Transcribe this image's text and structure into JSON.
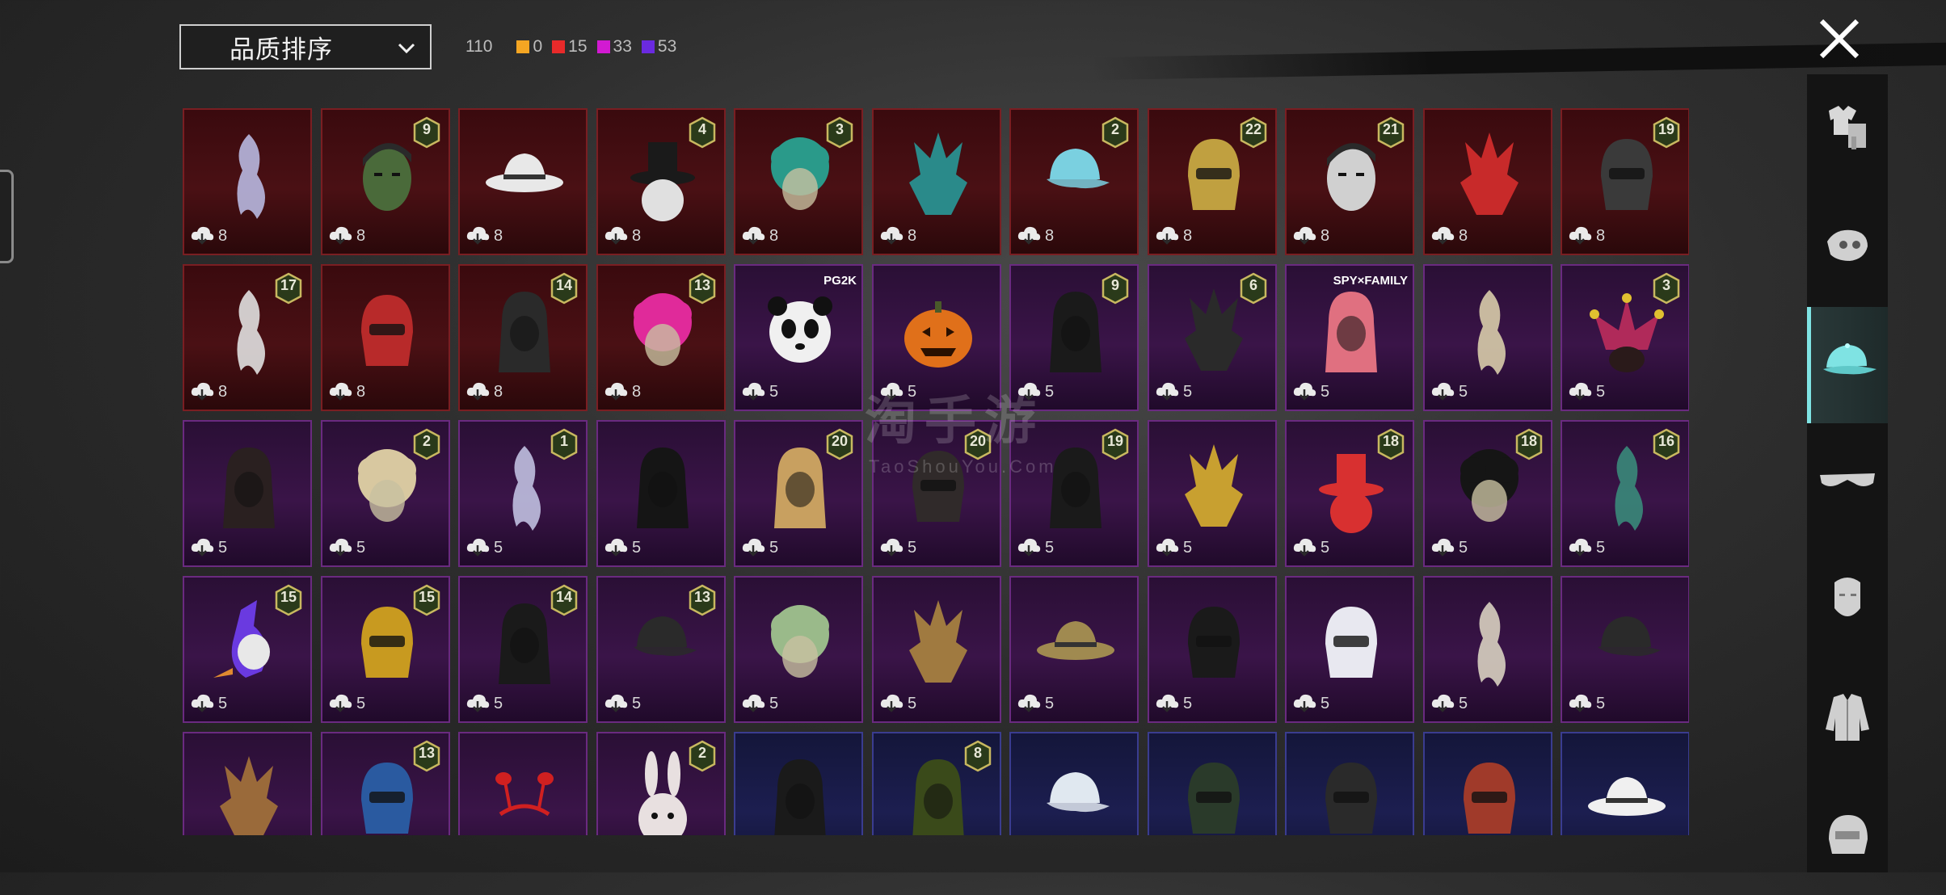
{
  "sort": {
    "label": "品质排序"
  },
  "counts": {
    "total": "110",
    "qualities": [
      {
        "color": "#f5a623",
        "value": "0"
      },
      {
        "color": "#e82a2a",
        "value": "15"
      },
      {
        "color": "#d21ad2",
        "value": "33"
      },
      {
        "color": "#6a2ae0",
        "value": "53"
      }
    ]
  },
  "watermark": {
    "main": "淘手游",
    "sub": "TaoShouYou.Com"
  },
  "sidebar": {
    "items": [
      {
        "icon": "outfit-icon"
      },
      {
        "icon": "mask-icon"
      },
      {
        "icon": "hat-icon",
        "active": true
      },
      {
        "icon": "glasses-icon"
      },
      {
        "icon": "face-icon"
      },
      {
        "icon": "jacket-icon"
      },
      {
        "icon": "helmet-icon"
      }
    ]
  },
  "rows": [
    [
      {
        "q": "red",
        "lvl": "",
        "cost": "8",
        "c": "#b8b8e0",
        "shape": "wisp"
      },
      {
        "q": "red",
        "lvl": "9",
        "cost": "8",
        "c": "#4a6a3a",
        "shape": "head"
      },
      {
        "q": "red",
        "lvl": "",
        "cost": "8",
        "c": "#e8e8e8",
        "shape": "cowboy"
      },
      {
        "q": "red",
        "lvl": "4",
        "cost": "8",
        "c": "#e0e0e0",
        "shape": "tophat"
      },
      {
        "q": "red",
        "lvl": "3",
        "cost": "8",
        "c": "#2a9a8a",
        "shape": "afro"
      },
      {
        "q": "red",
        "lvl": "",
        "cost": "8",
        "c": "#2a8a8a",
        "shape": "spiky"
      },
      {
        "q": "red",
        "lvl": "2",
        "cost": "8",
        "c": "#7ad0e0",
        "shape": "cap"
      },
      {
        "q": "red",
        "lvl": "22",
        "cost": "8",
        "c": "#c0a040",
        "shape": "helm"
      },
      {
        "q": "red",
        "lvl": "21",
        "cost": "8",
        "c": "#d0d0d0",
        "shape": "head"
      },
      {
        "q": "red",
        "lvl": "",
        "cost": "8",
        "c": "#c82a2a",
        "shape": "spiky"
      },
      {
        "q": "red",
        "lvl": "19",
        "cost": "8",
        "c": "#3a3a3a",
        "shape": "helm"
      }
    ],
    [
      {
        "q": "red",
        "lvl": "17",
        "cost": "8",
        "c": "#e0e0e0",
        "shape": "wisp"
      },
      {
        "q": "red",
        "lvl": "",
        "cost": "8",
        "c": "#b82a2a",
        "shape": "helm"
      },
      {
        "q": "red",
        "lvl": "14",
        "cost": "8",
        "c": "#2a2a2a",
        "shape": "hood"
      },
      {
        "q": "red",
        "lvl": "13",
        "cost": "8",
        "c": "#e02a9a",
        "shape": "afro"
      },
      {
        "q": "purple",
        "lvl": "",
        "cost": "5",
        "c": "#f0f0f0",
        "shape": "panda",
        "tag": "PG2K"
      },
      {
        "q": "purple",
        "lvl": "",
        "cost": "5",
        "c": "#e0701a",
        "shape": "pumpkin"
      },
      {
        "q": "purple",
        "lvl": "9",
        "cost": "5",
        "c": "#1a1a1a",
        "shape": "hood"
      },
      {
        "q": "purple",
        "lvl": "6",
        "cost": "5",
        "c": "#2a2a2a",
        "shape": "spiky"
      },
      {
        "q": "purple",
        "lvl": "",
        "cost": "5",
        "c": "#e07080",
        "shape": "hood",
        "tag": "SPY×FAMILY"
      },
      {
        "q": "purple",
        "lvl": "",
        "cost": "5",
        "c": "#d8ccaa",
        "shape": "wisp"
      },
      {
        "q": "purple",
        "lvl": "3",
        "cost": "5",
        "c": "#b02a5a",
        "shape": "jester"
      }
    ],
    [
      {
        "q": "purple",
        "lvl": "",
        "cost": "5",
        "c": "#2a2020",
        "shape": "hood"
      },
      {
        "q": "purple",
        "lvl": "2",
        "cost": "5",
        "c": "#d8c8a0",
        "shape": "afro"
      },
      {
        "q": "purple",
        "lvl": "1",
        "cost": "5",
        "c": "#c0c0e0",
        "shape": "wisp"
      },
      {
        "q": "purple",
        "lvl": "",
        "cost": "5",
        "c": "#151515",
        "shape": "hood"
      },
      {
        "q": "purple",
        "lvl": "20",
        "cost": "5",
        "c": "#c8a060",
        "shape": "hood"
      },
      {
        "q": "purple",
        "lvl": "20",
        "cost": "5",
        "c": "#302a2a",
        "shape": "helm"
      },
      {
        "q": "purple",
        "lvl": "19",
        "cost": "5",
        "c": "#1a1a1a",
        "shape": "hood"
      },
      {
        "q": "purple",
        "lvl": "",
        "cost": "5",
        "c": "#c8a030",
        "shape": "spiky"
      },
      {
        "q": "purple",
        "lvl": "18",
        "cost": "5",
        "c": "#d83030",
        "shape": "tophat"
      },
      {
        "q": "purple",
        "lvl": "18",
        "cost": "5",
        "c": "#151515",
        "shape": "afro"
      },
      {
        "q": "purple",
        "lvl": "16",
        "cost": "5",
        "c": "#3a8a7a",
        "shape": "wisp"
      }
    ],
    [
      {
        "q": "purple",
        "lvl": "15",
        "cost": "5",
        "c": "#6a3ae0",
        "shape": "bird"
      },
      {
        "q": "purple",
        "lvl": "15",
        "cost": "5",
        "c": "#c89a20",
        "shape": "helm"
      },
      {
        "q": "purple",
        "lvl": "14",
        "cost": "5",
        "c": "#1a1a1a",
        "shape": "hood"
      },
      {
        "q": "purple",
        "lvl": "13",
        "cost": "5",
        "c": "#2a2a2a",
        "shape": "cap"
      },
      {
        "q": "purple",
        "lvl": "",
        "cost": "5",
        "c": "#9aba8a",
        "shape": "afro"
      },
      {
        "q": "purple",
        "lvl": "",
        "cost": "5",
        "c": "#a07a40",
        "shape": "spiky"
      },
      {
        "q": "purple",
        "lvl": "",
        "cost": "5",
        "c": "#a08a50",
        "shape": "cowboy"
      },
      {
        "q": "purple",
        "lvl": "",
        "cost": "5",
        "c": "#1a1a1a",
        "shape": "helm"
      },
      {
        "q": "purple",
        "lvl": "",
        "cost": "5",
        "c": "#e8e8f0",
        "shape": "helm"
      },
      {
        "q": "purple",
        "lvl": "",
        "cost": "5",
        "c": "#d8d0c0",
        "shape": "wisp"
      },
      {
        "q": "purple",
        "lvl": "",
        "cost": "5",
        "c": "#2a2a2a",
        "shape": "cap"
      }
    ],
    [
      {
        "q": "purple",
        "lvl": "",
        "cost": "",
        "c": "#9a6a3a",
        "shape": "spiky"
      },
      {
        "q": "purple",
        "lvl": "13",
        "cost": "",
        "c": "#2a5aa0",
        "shape": "helm"
      },
      {
        "q": "purple",
        "lvl": "",
        "cost": "",
        "c": "#d02020",
        "shape": "antenna"
      },
      {
        "q": "purple",
        "lvl": "2",
        "cost": "",
        "c": "#e8e0e0",
        "shape": "bunny"
      },
      {
        "q": "blue",
        "lvl": "",
        "cost": "",
        "c": "#1a1a1a",
        "shape": "hood"
      },
      {
        "q": "blue",
        "lvl": "8",
        "cost": "",
        "c": "#3a4a1a",
        "shape": "hood"
      },
      {
        "q": "blue",
        "lvl": "",
        "cost": "",
        "c": "#e0e8f0",
        "shape": "cap"
      },
      {
        "q": "blue",
        "lvl": "",
        "cost": "",
        "c": "#2a3a2a",
        "shape": "helm"
      },
      {
        "q": "blue",
        "lvl": "",
        "cost": "",
        "c": "#2a2a2a",
        "shape": "helm"
      },
      {
        "q": "blue",
        "lvl": "",
        "cost": "",
        "c": "#a03a2a",
        "shape": "helm"
      },
      {
        "q": "blue",
        "lvl": "",
        "cost": "",
        "c": "#f0f0f0",
        "shape": "cowboy"
      }
    ]
  ]
}
